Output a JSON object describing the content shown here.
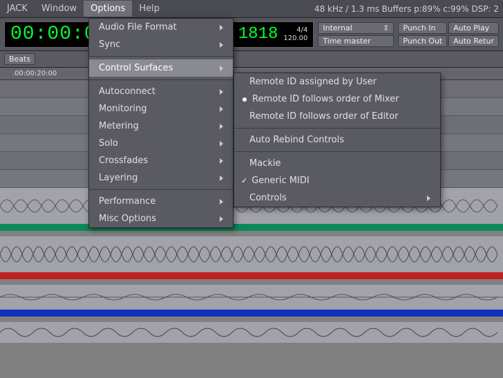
{
  "menubar": {
    "items": [
      "JACK",
      "Window",
      "Options",
      "Help"
    ],
    "active_index": 2,
    "status": "48 kHz /  1.3 ms  Buffers p:89% c:99%  DSP: 2"
  },
  "transport": {
    "timecode": "00:00:0",
    "bars": "1818",
    "timesig": "4/4",
    "tempo": "120.00",
    "clock_source": "Internal",
    "time_master": "Time master",
    "punch_in": "Punch In",
    "punch_out": "Punch Out",
    "auto_play": "Auto Play",
    "auto_return": "Auto Retur"
  },
  "secondary": {
    "beats_button": "Beats"
  },
  "ruler": {
    "label": ".00:00:20:00"
  },
  "options_menu": {
    "items": [
      {
        "label": "Audio File Format",
        "submenu": true
      },
      {
        "label": "Sync",
        "submenu": true
      },
      {
        "sep": true
      },
      {
        "label": "Control Surfaces",
        "submenu": true,
        "highlight": true
      },
      {
        "sep": true
      },
      {
        "label": "Autoconnect",
        "submenu": true
      },
      {
        "label": "Monitoring",
        "submenu": true
      },
      {
        "label": "Metering",
        "submenu": true
      },
      {
        "label": "Solo",
        "submenu": true
      },
      {
        "label": "Crossfades",
        "submenu": true
      },
      {
        "label": "Layering",
        "submenu": true
      },
      {
        "sep": true
      },
      {
        "label": "Performance",
        "submenu": true
      },
      {
        "label": "Misc Options",
        "submenu": true
      }
    ]
  },
  "control_surfaces_submenu": {
    "items": [
      {
        "label": "Remote ID assigned by User"
      },
      {
        "label": "Remote ID follows order of Mixer",
        "radio": true
      },
      {
        "label": "Remote ID follows order of Editor"
      },
      {
        "sep": true
      },
      {
        "label": "Auto Rebind Controls"
      },
      {
        "sep": true
      },
      {
        "label": "Mackie"
      },
      {
        "label": "Generic MIDI",
        "checked": true
      },
      {
        "label": "Controls",
        "submenu": true
      }
    ]
  }
}
